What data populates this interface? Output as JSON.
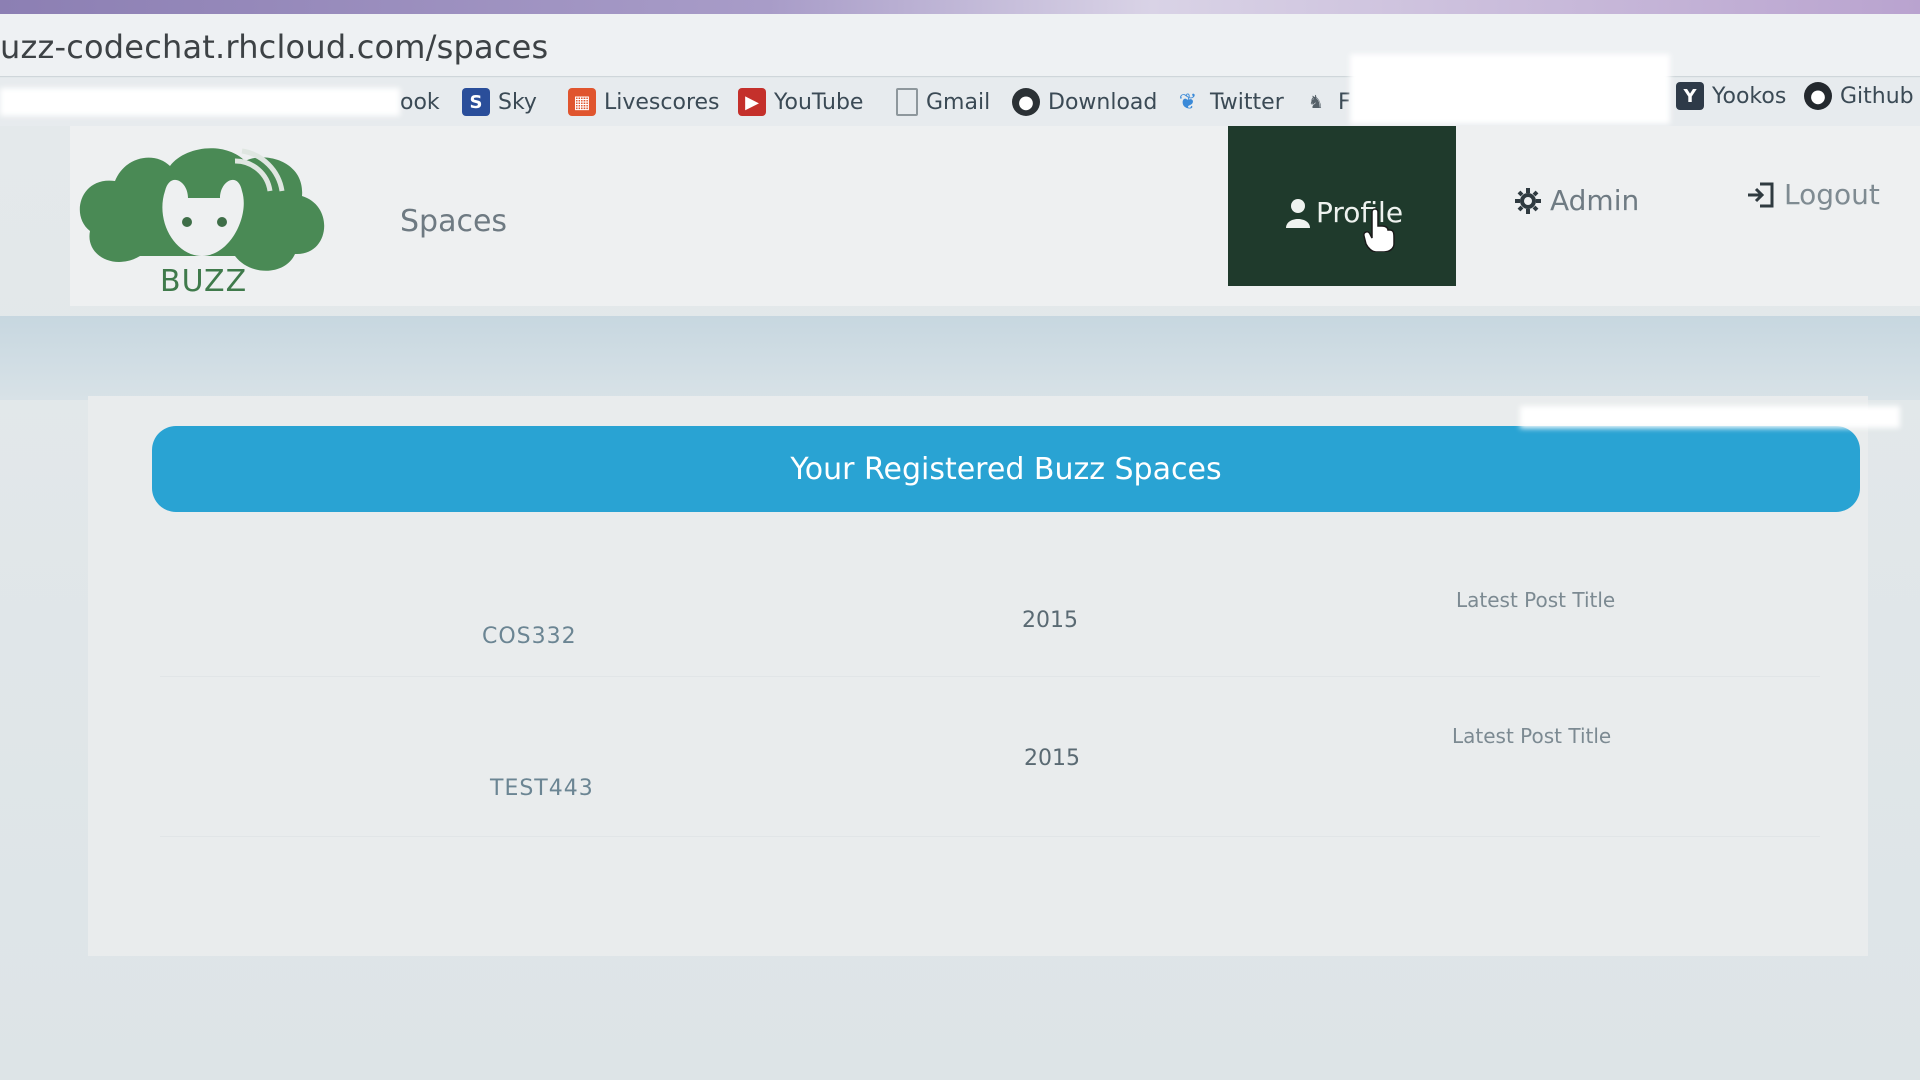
{
  "browser": {
    "url": "uzz-codechat.rhcloud.com/spaces",
    "bookmarks": [
      {
        "label": "ook",
        "icon": "bookmark-icon"
      },
      {
        "label": "Sky",
        "icon": "skype-icon"
      },
      {
        "label": "Livescores",
        "icon": "livescores-icon"
      },
      {
        "label": "YouTube",
        "icon": "youtube-icon"
      },
      {
        "label": "Gmail",
        "icon": "document-icon"
      },
      {
        "label": "Download",
        "icon": "download-icon"
      },
      {
        "label": "Twitter",
        "icon": "twitter-icon"
      },
      {
        "label": "F",
        "icon": "bunny-icon"
      },
      {
        "label": "Yookos",
        "icon": "yookos-icon"
      },
      {
        "label": "Github",
        "icon": "github-icon"
      }
    ]
  },
  "app": {
    "logo_text": "BUZZ",
    "nav": {
      "spaces": "Spaces",
      "profile": "Profile",
      "admin": "Admin",
      "logout": "Logout"
    }
  },
  "spaces": {
    "heading": "Your Registered Buzz Spaces",
    "rows": [
      {
        "name": "COS332",
        "year": "2015",
        "post": "Latest Post Title"
      },
      {
        "name": "TEST443",
        "year": "2015",
        "post": "Latest Post Title"
      }
    ]
  },
  "colors": {
    "accent": "#29a3d3",
    "profile_active": "#1f3a2c",
    "logo_green": "#3f7a4b"
  }
}
